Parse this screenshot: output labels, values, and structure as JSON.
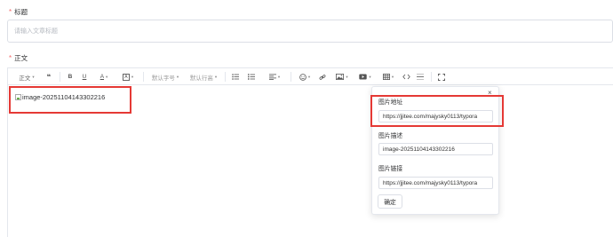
{
  "form": {
    "title_label": "标题",
    "title_placeholder": "请输入文章标题",
    "body_label": "正文"
  },
  "toolbar": {
    "paragraph": "正文",
    "quote": "❝",
    "bold": "B",
    "underline": "U",
    "font_color": "A",
    "bg_color": "A",
    "font_size": "默认字号",
    "line_height": "默认行高",
    "caret": "▾"
  },
  "content": {
    "image_alt": "image-20251104143302216"
  },
  "image_popover": {
    "url_label": "图片地址",
    "url_value": "https://jjitee.com/majysky0113/typora",
    "desc_label": "图片描述",
    "desc_value": "image-20251104143302216",
    "link_label": "图片链接",
    "link_value": "https://jjitee.com/majysky0113/typora",
    "confirm": "确定",
    "close": "×"
  },
  "colors": {
    "required": "#f56c6c",
    "highlight": "#e53935",
    "border": "#dcdfe6"
  }
}
